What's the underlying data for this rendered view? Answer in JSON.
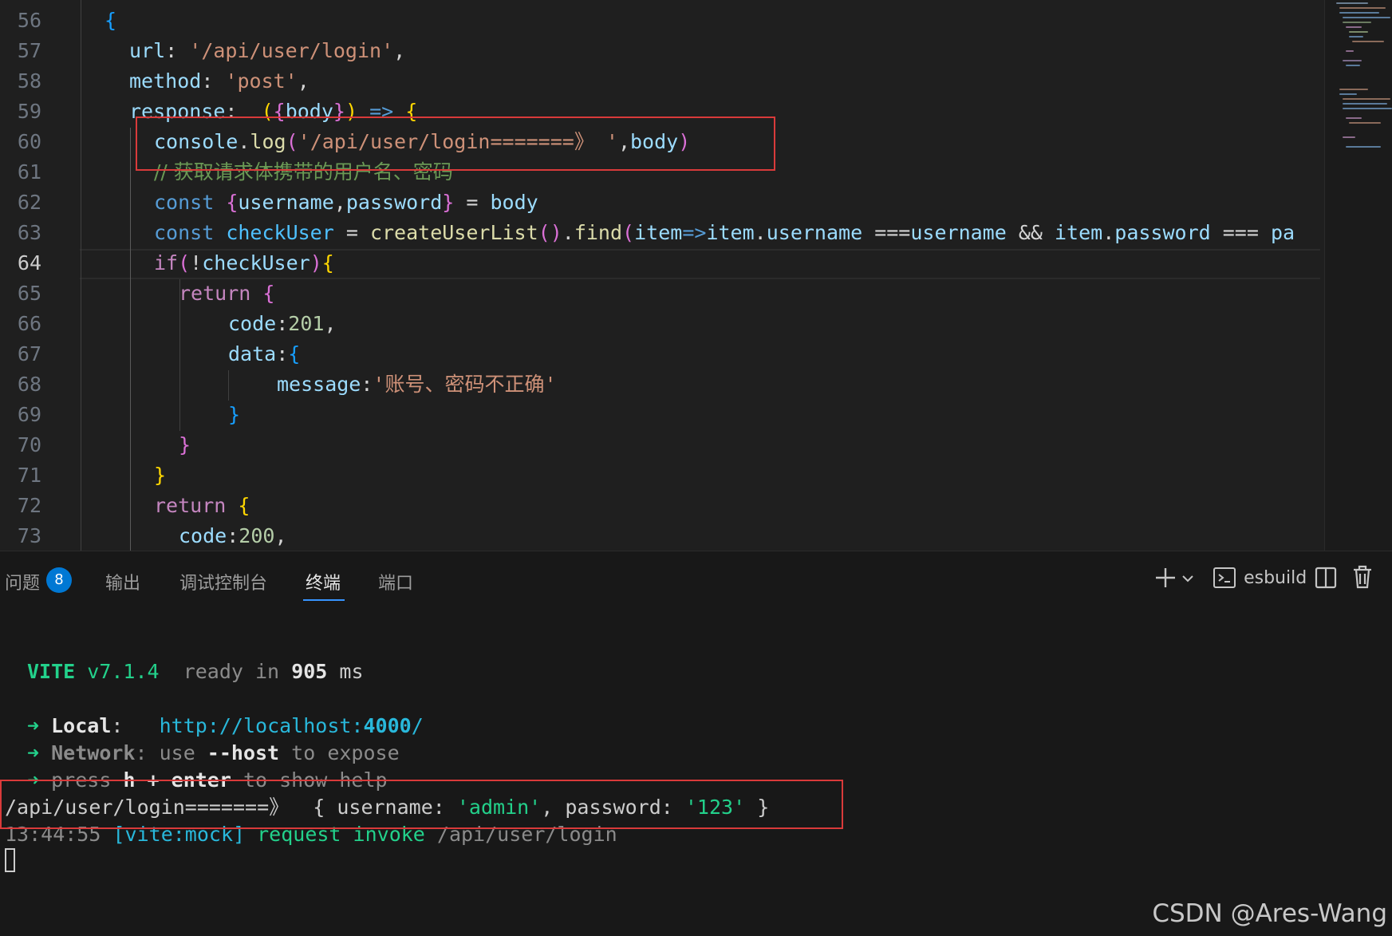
{
  "editor": {
    "line_numbers": [
      "56",
      "57",
      "58",
      "59",
      "60",
      "61",
      "62",
      "63",
      "64",
      "65",
      "66",
      "67",
      "68",
      "69",
      "70",
      "71",
      "72",
      "73"
    ],
    "active_line": "64",
    "lines": {
      "l56": "{",
      "l57a": "url",
      "l57b": ": ",
      "l57c": "'/api/user/login'",
      "l57d": ",",
      "l58a": "method",
      "l58b": ": ",
      "l58c": "'post'",
      "l58d": ",",
      "l59a": "response",
      "l59b": ":  ",
      "l59c": "(",
      "l59d": "{",
      "l59e": "body",
      "l59f": "}",
      "l59g": ")",
      "l59h": " => ",
      "l59i": "{",
      "l60a": "console",
      "l60b": ".",
      "l60c": "log",
      "l60d": "(",
      "l60e": "'/api/user/login=======》 '",
      "l60f": ",",
      "l60g": "body",
      "l60h": ")",
      "l61": "// 获取请求体携带的用户名、密码",
      "l62a": "const ",
      "l62b": "{",
      "l62c": "username",
      "l62d": ",",
      "l62e": "password",
      "l62f": "}",
      "l62g": " = ",
      "l62h": "body",
      "l63a": "const ",
      "l63b": "checkUser",
      "l63c": " = ",
      "l63d": "createUserList",
      "l63e": "()",
      "l63f": ".",
      "l63g": "find",
      "l63h": "(",
      "l63i": "item",
      "l63j": "=>",
      "l63k": "item",
      "l63l": ".",
      "l63m": "username",
      "l63n": " ===",
      "l63o": "username",
      "l63p": " && ",
      "l63q": "item",
      "l63r": ".",
      "l63s": "password",
      "l63t": " === ",
      "l63u": "pa",
      "l64a": "if",
      "l64b": "(",
      "l64c": "!",
      "l64d": "checkUser",
      "l64e": ")",
      "l64f": "{",
      "l65a": "return ",
      "l65b": "{",
      "l66a": "code",
      "l66b": ":",
      "l66c": "201",
      "l66d": ",",
      "l67a": "data",
      "l67b": ":",
      "l67c": "{",
      "l68a": "message",
      "l68b": ":",
      "l68c": "'账号、密码不正确'",
      "l69": "}",
      "l70": "}",
      "l71": "}",
      "l72a": "return ",
      "l72b": "{",
      "l73a": "code",
      "l73b": ":",
      "l73c": "200",
      "l73d": ","
    }
  },
  "panel": {
    "tabs": [
      {
        "label": "问题"
      },
      {
        "label": "输出"
      },
      {
        "label": "调试控制台"
      },
      {
        "label": "终端"
      },
      {
        "label": "端口"
      }
    ],
    "active_tab": "终端",
    "problems_count": "8",
    "terminal_profile": "esbuild",
    "icons": [
      "plus-icon",
      "chevron-down-icon",
      "terminal-icon",
      "split-icon",
      "trash-icon"
    ]
  },
  "terminal": {
    "vite_line": {
      "name": "VITE",
      "version": "v7.1.4",
      "ready": "ready in",
      "ms_value": "905",
      "ms_unit": "ms"
    },
    "local": {
      "arrow": "➜",
      "label": "Local",
      "colon": ":",
      "url_a": "http://localhost:",
      "url_port": "4000",
      "url_b": "/"
    },
    "network": {
      "arrow": "➜",
      "label": "Network",
      "text_a": ": use ",
      "flag": "--host",
      "text_b": " to expose"
    },
    "help": {
      "arrow": "➜",
      "text_a": "press ",
      "key_h": "h",
      "plus": " + ",
      "key_enter": "enter",
      "text_b": " to show help"
    },
    "log": {
      "prefix": "/api/user/login=======》  { ",
      "k1": "username",
      "c1": ": ",
      "v1": "'admin'",
      "sep": ", ",
      "k2": "password",
      "c2": ": ",
      "v2": "'123'",
      "end": " }"
    },
    "mock": {
      "time": "13:44:55",
      "tag": "[vite:mock]",
      "msg": "request invoke",
      "path": "/api/user/login"
    }
  },
  "watermark": "CSDN @Ares-Wang",
  "colors": {
    "accent": "#0078d4",
    "highlight_box": "#d93a3a",
    "vite_green": "#23d18b",
    "link_cyan": "#29b8db"
  }
}
